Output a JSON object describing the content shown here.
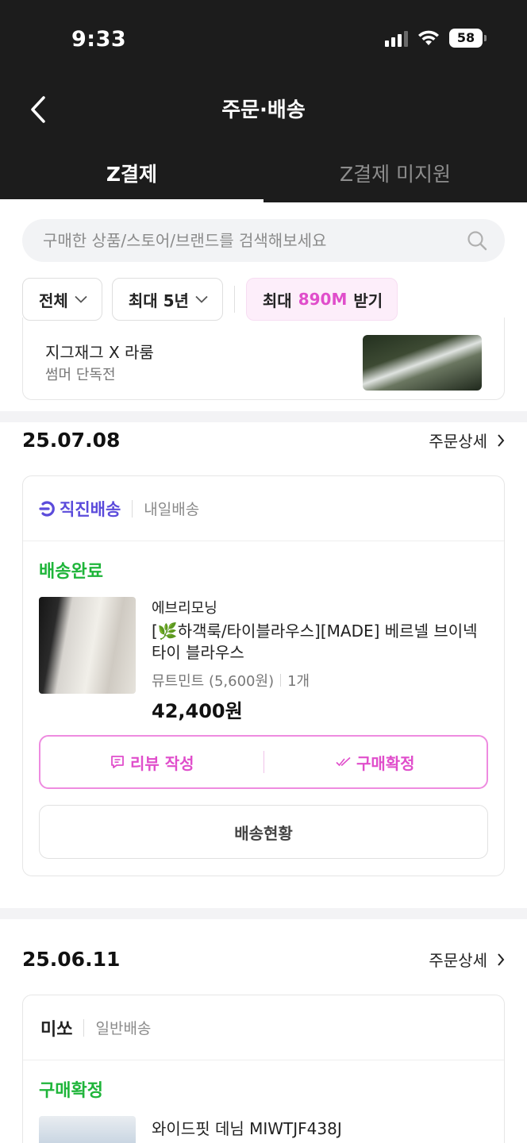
{
  "status_bar": {
    "time": "9:33",
    "battery": "58"
  },
  "header": {
    "title": "주문·배송"
  },
  "tabs": [
    {
      "label": "Z결제"
    },
    {
      "label": "Z결제 미지원"
    }
  ],
  "search": {
    "placeholder": "구매한 상품/스토어/브랜드를 검색해보세요"
  },
  "filters": {
    "type": "전체",
    "period": "최대 5년",
    "promo_prefix": "최대",
    "promo_amount": "890M",
    "promo_suffix": "받기"
  },
  "partial_item": {
    "title": "지그재그 X 라룸",
    "subtitle": "썸머 단독전"
  },
  "orders": [
    {
      "date": "25.07.08",
      "detail_label": "주문상세",
      "delivery_badge": "직진배송",
      "delivery_type": "내일배송",
      "status": "배송완료",
      "product": {
        "brand": "에브리모닝",
        "name": "[🌿하객룩/타이블라우스][MADE] 베르넬 브이넥 타이 블라우스",
        "option": "뮤트민트 (5,600원)",
        "quantity": "1개",
        "price": "42,400원"
      },
      "buttons": {
        "review": "리뷰 작성",
        "confirm": "구매확정",
        "tracking": "배송현황"
      }
    },
    {
      "date": "25.06.11",
      "detail_label": "주문상세",
      "store": "미쏘",
      "delivery_type": "일반배송",
      "status": "구매확정",
      "product": {
        "name": "와이드핏 데님 MIWTJF438J"
      }
    }
  ],
  "colors": {
    "accent_pink": "#e04ecb",
    "status_green": "#1fb53a",
    "direct_purple": "#5b4bdb",
    "header_bg": "#1c1c1c"
  }
}
